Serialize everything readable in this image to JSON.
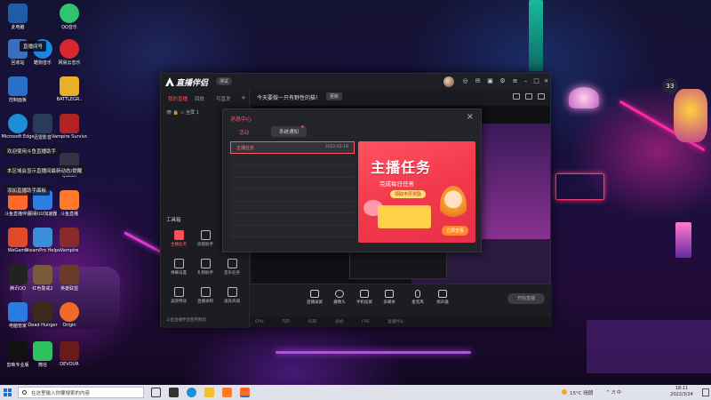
{
  "desktop": {
    "icons": [
      {
        "label": "此电脑",
        "color": "#1e5ca8"
      },
      {
        "label": "QQ音乐",
        "color": "#2fc470"
      },
      {
        "label": "回收站",
        "color": "#3a6fbf"
      },
      {
        "label": "酷狗音乐",
        "color": "#1b86e0"
      },
      {
        "label": "网易云音乐",
        "color": "#d8272f"
      },
      {
        "label": "控制面板",
        "color": "#2a70c8"
      },
      {
        "label": "BATTLEGR..",
        "color": "#e8b02a"
      },
      {
        "label": "Microsoft Edge",
        "color": "#1a8fd6"
      },
      {
        "label": "迅雷影音",
        "color": "#2a3a5a"
      },
      {
        "label": "Vampire Survivors",
        "color": "#b22222"
      },
      {
        "label": "Queen",
        "color": "#333344"
      },
      {
        "label": "斗鱼直播伴侣",
        "color": "#ff6a2a"
      },
      {
        "label": "网易UU加速器",
        "color": "#2c7fe0"
      },
      {
        "label": "斗鱼直播",
        "color": "#ff7a2a"
      },
      {
        "label": "WeGame",
        "color": "#e04a2a"
      },
      {
        "label": "SteamPro Helper",
        "color": "#3a8fd8"
      },
      {
        "label": "Vampire",
        "color": "#8a2a2a"
      },
      {
        "label": "腾讯QQ",
        "color": "#222"
      },
      {
        "label": "红色警戒2",
        "color": "#7a5a3a"
      },
      {
        "label": "英雄联盟",
        "color": "#6a3a2a"
      },
      {
        "label": "电脑管家",
        "color": "#2a7ae0"
      },
      {
        "label": "Dead Hunger",
        "color": "#3a2a1a"
      },
      {
        "label": "Origin",
        "color": "#f06a2a"
      },
      {
        "label": "剪映专业版",
        "color": "#111"
      },
      {
        "label": "微信",
        "color": "#2fc060"
      },
      {
        "label": "DEVOUR",
        "color": "#6a1a1a"
      }
    ],
    "tips": [
      "欢迎使用斗鱼直播助手",
      "本区域会显示直播间最新动态/提醒",
      "添加直播助手面板"
    ],
    "bilibili_live_text": "直播间号",
    "viewer_badge": "33"
  },
  "app": {
    "title": "直播伴侣",
    "version_badge": "测试",
    "left_tabs": [
      "我的直播",
      "回放",
      "可直发"
    ],
    "scene_label": "全屏 1",
    "notice_text": "今天要做一只有野性的猫！",
    "notice_button": "更新",
    "tools_title": "工具箱",
    "tools": [
      {
        "label": "主播任务",
        "hot": true
      },
      {
        "label": "房管助手",
        "hot": false
      },
      {
        "label": "弹幕设置",
        "hot": false
      },
      {
        "label": "礼物助手",
        "hot": false
      },
      {
        "label": "音乐任务",
        "hot": false
      },
      {
        "label": "美颜特效",
        "hot": false
      },
      {
        "label": "直播录制",
        "hot": false
      },
      {
        "label": "道具商城",
        "hot": false
      },
      {
        "label": "录屏精灵",
        "hot": false
      }
    ],
    "left_footer": "斗鱼直播伴侣使用教程",
    "controls": [
      "直播录屏",
      "摄像头",
      "手机投屏",
      "多媒体",
      "麦克风",
      "扬声器"
    ],
    "start_button": "开始直播",
    "status_items": [
      "CPU:",
      "内存:",
      "码率:",
      "丢帧:",
      "FPS:",
      "直播时长:"
    ]
  },
  "dialog": {
    "title": "消息中心",
    "close_glyph": "×",
    "tabs": [
      "活动",
      "系统通知"
    ],
    "tasks": [
      {
        "name": "主播任务",
        "date": "2022-05-18"
      }
    ],
    "banner": {
      "title": "主播任务",
      "subtitle": "完成每日任务",
      "pill": "领取丰厚奖励",
      "button": "立即查看"
    }
  },
  "taskbar": {
    "search_placeholder": "在这里输入你要搜索的内容",
    "weather": "15°C 晴朗",
    "tray_text": "^ ♬ 中",
    "time": "18:11",
    "date": "2022/3/24"
  }
}
